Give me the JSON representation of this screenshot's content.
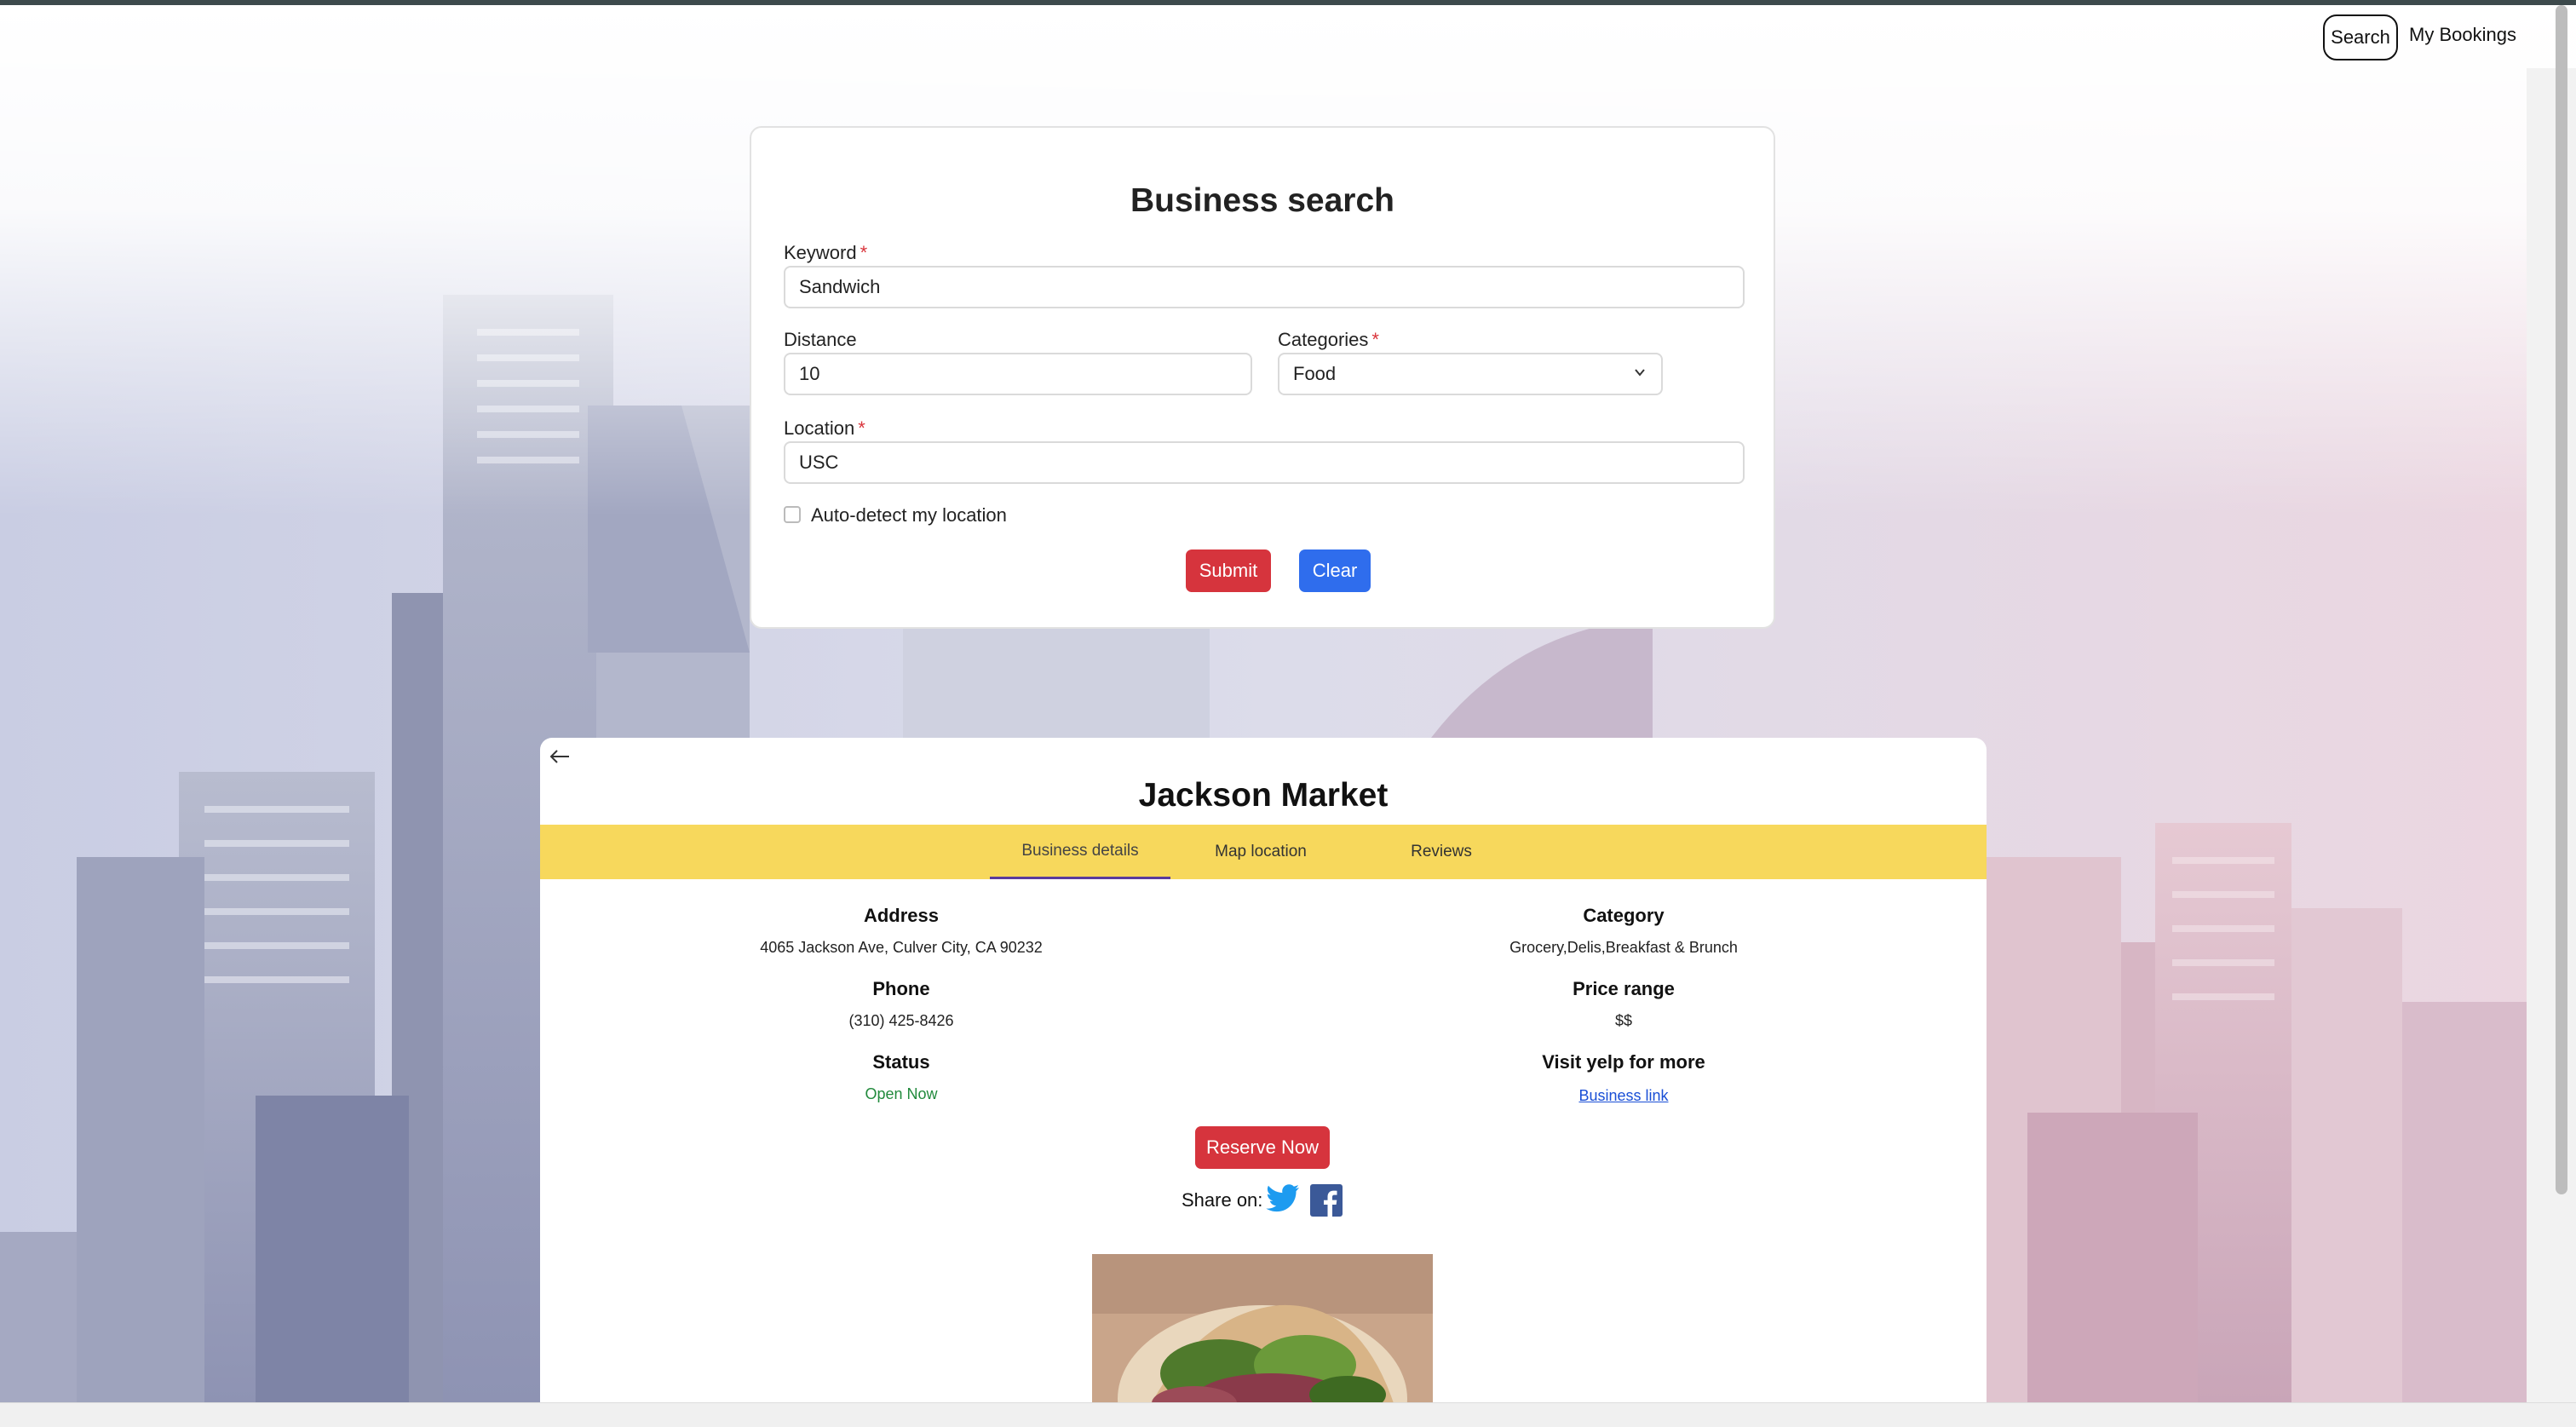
{
  "nav": {
    "search_label": "Search",
    "bookings_label": "My Bookings"
  },
  "search_form": {
    "title": "Business search",
    "keyword_label": "Keyword",
    "keyword_value": "Sandwich",
    "distance_label": "Distance",
    "distance_value": "10",
    "categories_label": "Categories",
    "categories_value": "Food",
    "location_label": "Location",
    "location_value": "USC",
    "required_mark": "*",
    "autodetect_label": "Auto-detect my location",
    "autodetect_checked": false,
    "submit_label": "Submit",
    "clear_label": "Clear"
  },
  "business": {
    "name": "Jackson Market",
    "tabs": [
      {
        "label": "Business details",
        "active": true
      },
      {
        "label": "Map location",
        "active": false
      },
      {
        "label": "Reviews",
        "active": false
      }
    ],
    "address_label": "Address",
    "address_value": "4065 Jackson Ave, Culver City, CA 90232",
    "phone_label": "Phone",
    "phone_value": "(310) 425-8426",
    "status_label": "Status",
    "status_value": "Open Now",
    "category_label": "Category",
    "category_value": "Grocery,Delis,Breakfast & Brunch",
    "price_label": "Price range",
    "price_value": "$$",
    "yelp_label": "Visit yelp for more",
    "yelp_link": "Business link",
    "reserve_label": "Reserve Now",
    "share_label": "Share on:"
  },
  "colors": {
    "submit": "#d6343d",
    "clear": "#2f6ded",
    "tab_bar": "#f7d85c",
    "tab_underline": "#5a3b9c",
    "open_status": "#218a3c"
  },
  "icons": [
    "back-arrow-icon",
    "chevron-down-icon",
    "twitter-icon",
    "facebook-icon"
  ]
}
